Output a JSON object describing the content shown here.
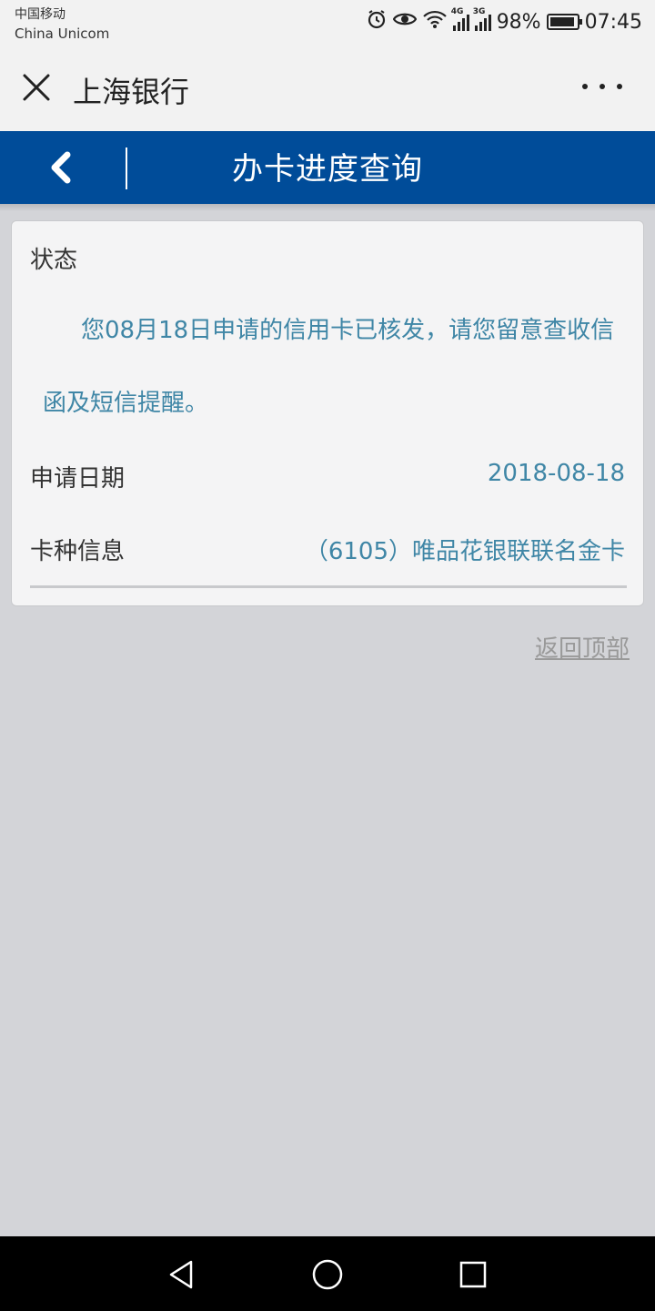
{
  "status_bar": {
    "carrier_line1": "中国移动",
    "carrier_line2": "China Unicom",
    "network1": "4G",
    "network2": "3G",
    "battery": "98%",
    "time": "07:45",
    "icons": [
      "alarm-icon",
      "eye-icon",
      "wifi-icon",
      "signal-icon",
      "battery-icon"
    ]
  },
  "title_bar": {
    "title": "上海银行",
    "close_icon": "close-icon",
    "more_icon": "more-icon"
  },
  "header": {
    "title": "办卡进度查询",
    "back_icon": "chevron-left-icon",
    "background": "#004c99"
  },
  "card": {
    "status_label": "状态",
    "status_message": "您08月18日申请的信用卡已核发，请您留意查收信函及短信提醒。",
    "date_label": "申请日期",
    "date_value": "2018-08-18",
    "card_label": "卡种信息",
    "card_value": "（6105）唯品花银联联名金卡",
    "value_color": "#3f86a6"
  },
  "back_to_top": "返回顶部",
  "nav_bar": {
    "back_icon": "triangle-back-icon",
    "home_icon": "circle-home-icon",
    "recent_icon": "square-recent-icon"
  }
}
